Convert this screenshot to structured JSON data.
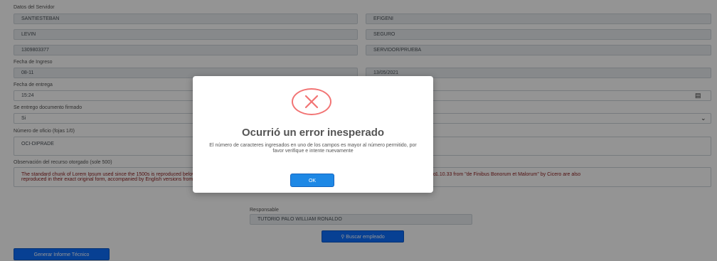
{
  "form": {
    "field_labels": {
      "datos_servidor": "Datos del Servidor",
      "fecha_ingreso": "Fecha de Ingreso",
      "fecha_entrega": "Fecha de entrega",
      "se_entrego_en_que_calidad": "Se entrego documento firmado",
      "numero_de_oficio": "Número de oficio (fojas 1/0)",
      "observaciones": "Observación del recurso otorgado (sole 500)"
    },
    "row1_left": "SANTIESTEBAN",
    "row1_right": "EFIGENI",
    "row2_left": "LEVIN",
    "row2_right": "SEGURO",
    "row3_left": "1309803377",
    "row3_right": "SERVIDOR/PRUEBA",
    "fecha_ingreso_value": "08-11",
    "fecha_ingreso_right": "13/05/2021",
    "fecha_entrega_value": "15:24",
    "si_no_value": "Si",
    "oficio_value": "OCI-DIPRADE",
    "observaciones_left": "The standard chunk of Lorem Ipsum used since the 1500s is reproduced below for those interested. Sections 1.10.32 and 1.10.33 from \"de Finibus Bonorum et Malorum\" by Cicero are also reproduced in their exact original form, accompanied by English versions from the 1914 translation by H. Rackham.",
    "observaciones_right": "1.10.33 from \"de Finibus Bonorum et Malorum\" by Cicero are also",
    "responsable_label": "Responsable",
    "responsable_value": "TUTORIO PALO WILLIAM RONALDO",
    "buscar_button": "Buscar empleado",
    "generar_button": "Generar Informe Técnico"
  },
  "icons": {
    "calendar": "calendar-icon",
    "chevron": "chevron-down-icon",
    "search": "search-icon",
    "error": "error-x-icon"
  },
  "modal": {
    "title": "Ocurrió un error inesperado",
    "message": "El número de caracteres ingresados en uno de los campos es mayor al número permitido, por favor verifique e intente nuevamente",
    "ok_button": "OK"
  },
  "colors": {
    "primary_button": "#0d6efd",
    "error_red": "#f27474",
    "ok_button": "#1e88e5"
  }
}
